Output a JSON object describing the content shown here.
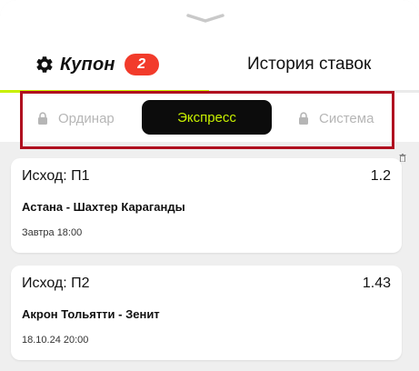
{
  "header": {
    "tabs": {
      "coupon": {
        "label": "Купон",
        "badge_count": "2",
        "active": true
      },
      "history": {
        "label": "История ставок",
        "active": false
      }
    }
  },
  "bet_mode": {
    "options": [
      {
        "label": "Ординар",
        "locked": true,
        "selected": false
      },
      {
        "label": "Экспресс",
        "locked": false,
        "selected": true
      },
      {
        "label": "Система",
        "locked": true,
        "selected": false
      }
    ]
  },
  "bets": [
    {
      "outcome": "Исход: П1",
      "odds": "1.2",
      "match": "Астана - Шахтер Караганды",
      "time": "Завтра 18:00"
    },
    {
      "outcome": "Исход: П2",
      "odds": "1.43",
      "match": "Акрон Тольятти - Зенит",
      "time": "18.10.24 20:00"
    }
  ],
  "icons": [
    "chevron-down-icon",
    "gear-icon",
    "lock-icon",
    "trash-icon"
  ],
  "colors": {
    "accent": "#c8f000",
    "badge": "#f23b2b",
    "express_bg": "#0c0c0c",
    "highlight_outline": "#b01020",
    "disabled_text": "#b6b6b6",
    "sheet_background": "#efefef"
  }
}
